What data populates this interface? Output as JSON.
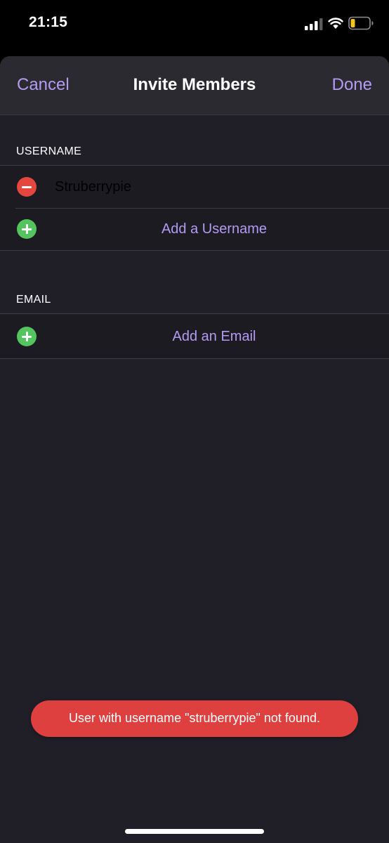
{
  "status_bar": {
    "time": "21:15",
    "signal_icon": "cellular-signal-icon",
    "wifi_icon": "wifi-icon",
    "battery_icon": "battery-low-icon",
    "battery_color": "#f5c518"
  },
  "nav": {
    "cancel_label": "Cancel",
    "title": "Invite Members",
    "done_label": "Done"
  },
  "username_section": {
    "header": "USERNAME",
    "entries": [
      {
        "value": "Struberrypie",
        "remove_icon": "remove-circle-icon"
      }
    ],
    "add_label": "Add a Username",
    "add_icon": "add-circle-icon"
  },
  "email_section": {
    "header": "EMAIL",
    "add_label": "Add an Email",
    "add_icon": "add-circle-icon"
  },
  "toast": {
    "message": "User with username \"struberrypie\" not found.",
    "color": "#de4040"
  },
  "colors": {
    "accent": "#b39bf2",
    "remove": "#e5473e",
    "add": "#54c45e",
    "background": "#201f28"
  }
}
